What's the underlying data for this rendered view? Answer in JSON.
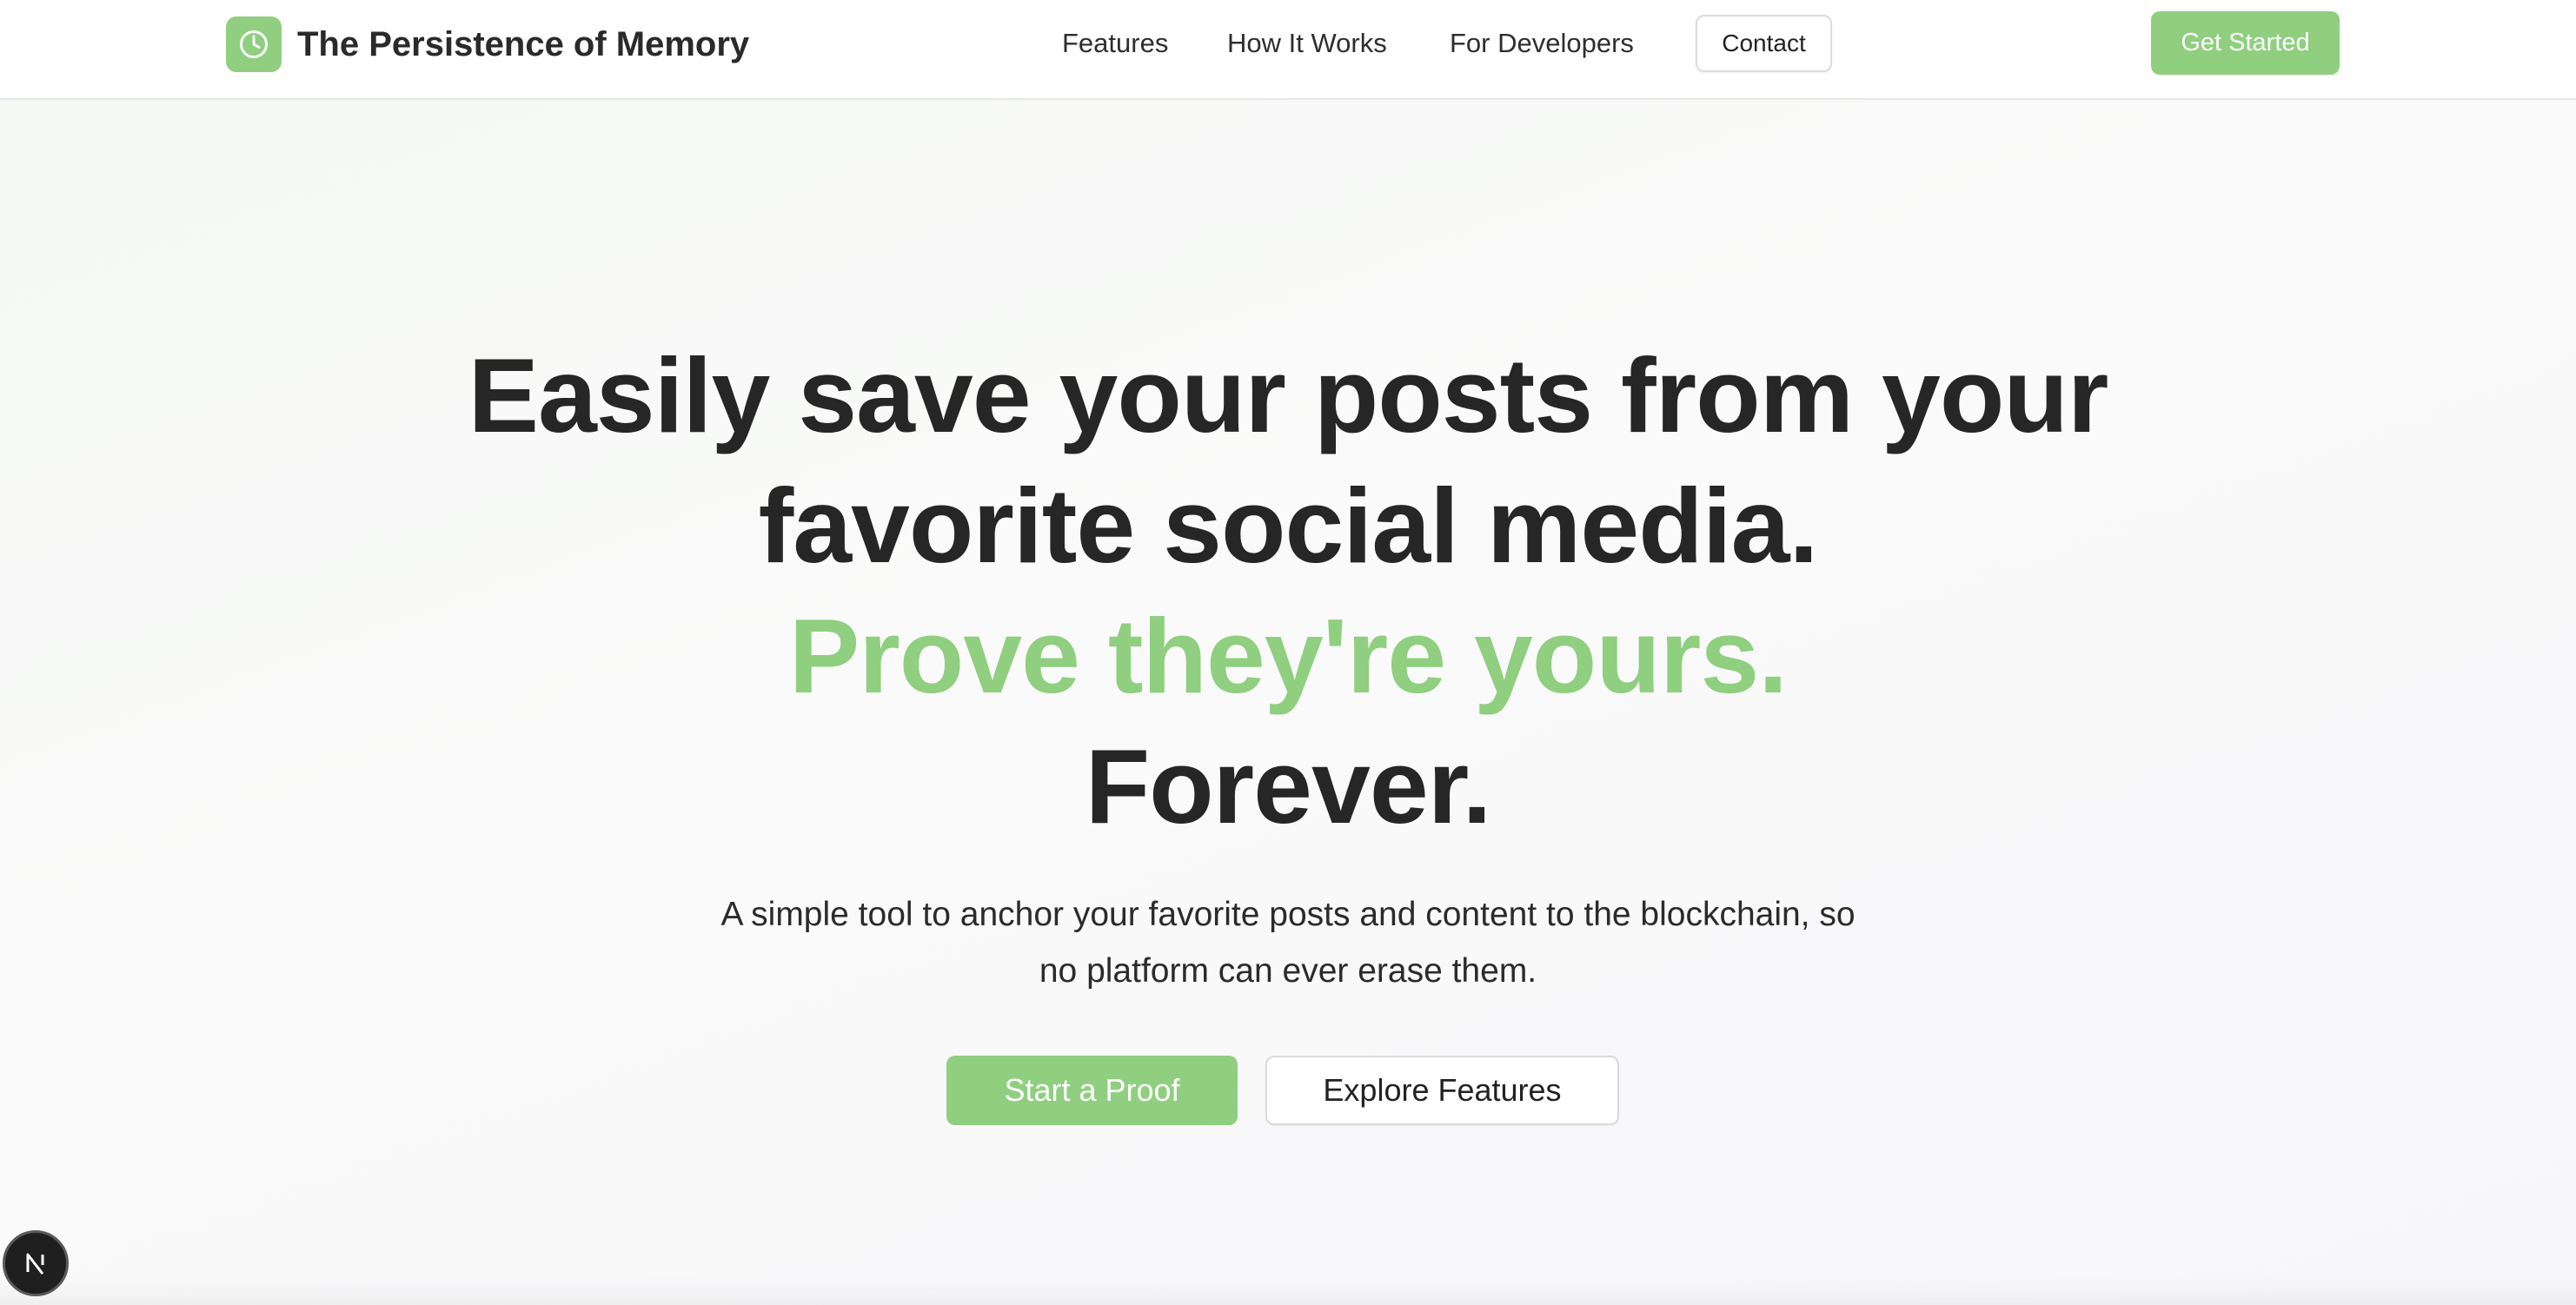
{
  "header": {
    "brand": {
      "name": "The Persistence of Memory",
      "logo_icon": "clock-icon"
    },
    "nav": [
      {
        "label": "Features"
      },
      {
        "label": "How It Works"
      },
      {
        "label": "For Developers"
      }
    ],
    "contact_label": "Contact",
    "get_started_label": "Get Started"
  },
  "hero": {
    "title_line_1": "Easily save your posts from your",
    "title_line_2": "favorite social media.",
    "title_accent": "Prove they're yours.",
    "title_line_4": "Forever.",
    "subtitle_line_1": "A simple tool to anchor your favorite posts and content to the blockchain, so",
    "subtitle_line_2": "no platform can ever erase them.",
    "primary_cta": "Start a Proof",
    "secondary_cta": "Explore Features"
  },
  "floating_button": {
    "icon": "next-logo-icon"
  },
  "colors": {
    "accent": "#8fcf7f",
    "text": "#262626",
    "background": "#fafafa"
  }
}
